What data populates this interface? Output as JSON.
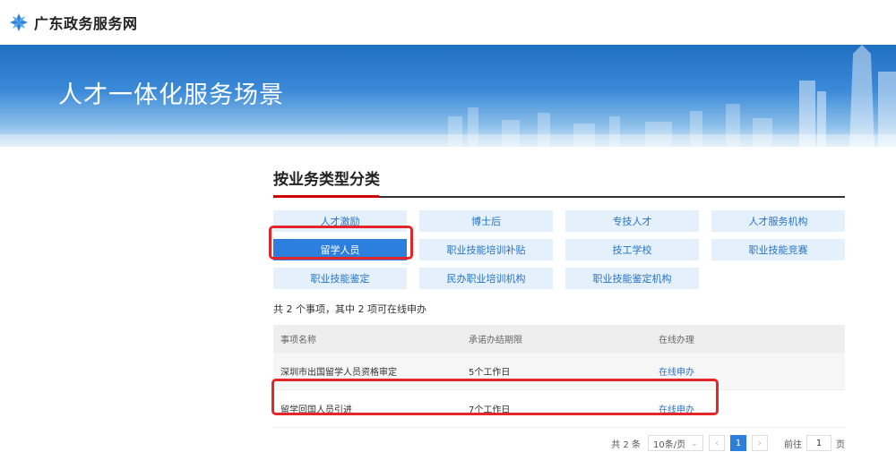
{
  "header": {
    "site_name": "广东政务服务网",
    "logo_icon": "guangdong-gov-logo-icon"
  },
  "banner": {
    "title": "人才一体化服务场景"
  },
  "section": {
    "title": "按业务类型分类"
  },
  "categories": [
    {
      "label": "人才激励"
    },
    {
      "label": "博士后"
    },
    {
      "label": "专技人才"
    },
    {
      "label": "人才服务机构"
    },
    {
      "label": "留学人员",
      "active": true
    },
    {
      "label": "职业技能培训补贴"
    },
    {
      "label": "技工学校"
    },
    {
      "label": "职业技能竞赛"
    },
    {
      "label": "职业技能鉴定"
    },
    {
      "label": "民办职业培训机构"
    },
    {
      "label": "职业技能鉴定机构"
    }
  ],
  "summary": "共 2 个事项，其中 2 项可在线申办",
  "table": {
    "headers": [
      "事项名称",
      "承诺办结期限",
      "在线办理"
    ],
    "rows": [
      {
        "name": "深圳市出国留学人员资格审定",
        "deadline": "5个工作日",
        "action": "在线申办"
      },
      {
        "name": "留学回国人员引进",
        "deadline": "7个工作日",
        "action": "在线申办"
      }
    ]
  },
  "pager": {
    "total": "共 2 条",
    "page_size": "10条/页",
    "prev": "‹",
    "current": "1",
    "next": "›",
    "goto_label": "前往",
    "goto_value": "1",
    "goto_suffix": "页"
  },
  "colors": {
    "accent": "#2d7fde",
    "highlight": "#e3262a",
    "link": "#2573c9"
  }
}
